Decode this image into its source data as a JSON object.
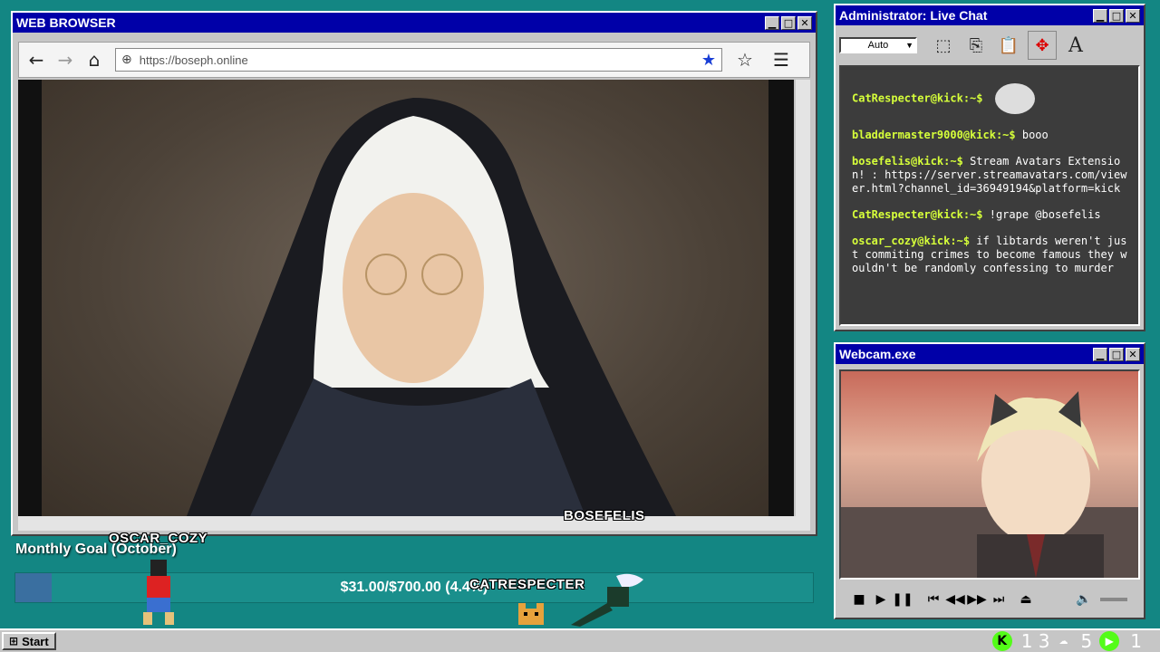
{
  "browser": {
    "title": "WEB BROWSER",
    "url": "https://boseph.online",
    "caption": "BOSEFELIS"
  },
  "chat": {
    "title": "Administrator: Live Chat",
    "font_select": "Auto",
    "messages": [
      {
        "user": "CatRespecter@kick:~$",
        "text": ""
      },
      {
        "user": "bladdermaster9000@kick:~$",
        "text": "booo"
      },
      {
        "user": "bosefelis@kick:~$",
        "text": "Stream Avatars Extension! : https://server.streamavatars.com/viewer.html?channel_id=36949194&platform=kick"
      },
      {
        "user": "CatRespecter@kick:~$",
        "text": "!grape @bosefelis"
      },
      {
        "user": "oscar_cozy@kick:~$",
        "text": "if libtards weren't just commiting crimes to become famous they wouldn't be randomly confessing to murder"
      }
    ]
  },
  "webcam": {
    "title": "Webcam.exe"
  },
  "goal": {
    "label": "Monthly Goal (October)",
    "progress_text": "$31.00/$700.00 (4.4%)",
    "progress_fraction": 0.044
  },
  "avatars": {
    "name1": "OSCAR_COZY",
    "name2": "CATRESPECTER"
  },
  "taskbar": {
    "start_label": "Start",
    "tray_left": "1 3",
    "tray_right": "5",
    "tray_count": "1",
    "colors": {
      "kick_green": "#53fc18"
    }
  }
}
